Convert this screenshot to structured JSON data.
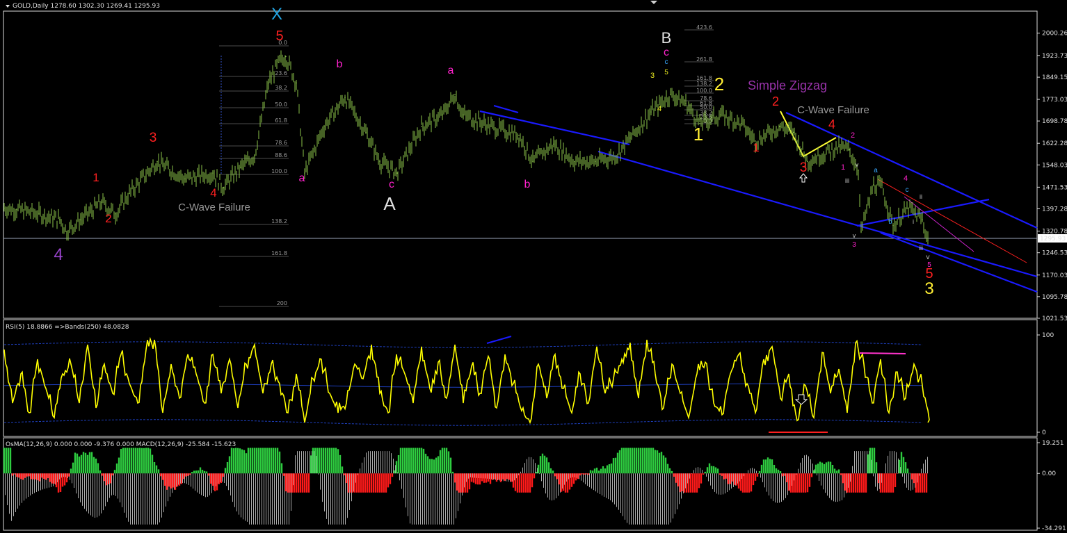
{
  "header": {
    "main": "GOLD,Daily  1278.60 1302.30 1269.41 1295.93",
    "rsi": "RSI(5) 18.8866  =>Bands(250) 48.0828",
    "osma": "OsMA(12,26,9) 0.000 0.000 -9.376 0.000  MACD(12,26,9) -25.584 -15.623"
  },
  "colors": {
    "background": "#000000",
    "candle": "#8bc34a",
    "trendline": "#1a1aff",
    "rsi": "#ffff00",
    "band": "#1e3fbf",
    "macd_pos": "#2ecc40",
    "macd_neg": "#ff1a1a",
    "signal": "#d8d8d8",
    "grid": "#ffffff"
  },
  "chart_data": [
    {
      "type": "line",
      "name": "GOLD,Daily",
      "ylim": [
        1021.53,
        2076.0
      ],
      "y_ticks": [
        "2000.26",
        "1923.73",
        "1849.15",
        "1773.03",
        "1698.78",
        "1622.28",
        "1548.03",
        "1471.53",
        "1397.28",
        "1320.78",
        "1295.93",
        "1246.53",
        "1170.03",
        "1095.78",
        "1021.53"
      ],
      "last_price": "1295.93",
      "series": [
        {
          "x": [
            0,
            18,
            50,
            80,
            90,
            110,
            140,
            160,
            180,
            220,
            260,
            300,
            315,
            340,
            360,
            380,
            395,
            405,
            420,
            432,
            460,
            490,
            520,
            540,
            565,
            600,
            630,
            648,
            660,
            700,
            740,
            760,
            790,
            820,
            850,
            880,
            900,
            930,
            958,
            980,
            1000,
            1030,
            1060,
            1080,
            1115,
            1135,
            1155,
            1200,
            1215,
            1228,
            1232,
            1250,
            1262,
            1278,
            1300,
            1310,
            1320,
            1328
          ],
          "y": [
            1400,
            1395,
            1380,
            1360,
            1320,
            1360,
            1420,
            1380,
            1450,
            1560,
            1500,
            1520,
            1470,
            1540,
            1580,
            1830,
            1900,
            1920,
            1830,
            1520,
            1680,
            1780,
            1660,
            1560,
            1520,
            1680,
            1720,
            1790,
            1720,
            1680,
            1650,
            1560,
            1620,
            1560,
            1560,
            1580,
            1640,
            1730,
            1790,
            1760,
            1690,
            1720,
            1690,
            1630,
            1680,
            1660,
            1560,
            1610,
            1600,
            1530,
            1320,
            1480,
            1470,
            1340,
            1400,
            1380,
            1360,
            1290
          ]
        }
      ],
      "fib_levels": [
        "423.6",
        "261.8",
        "161.8",
        "138.2",
        "100.0",
        "78.6",
        "61.8",
        "50.0",
        "38.2",
        "23.6",
        "0.0",
        "88.6",
        "200"
      ],
      "annotations": [
        {
          "text": "X",
          "color": "#22a8e8"
        },
        {
          "text": "5",
          "color": "#ff2020"
        },
        {
          "text": "B",
          "color": "#e0e0e0"
        },
        {
          "text": "c",
          "color": "#ff22cc"
        },
        {
          "text": "c",
          "color": "#38a8ff"
        },
        {
          "text": "5",
          "color": "#e8e820"
        },
        {
          "text": "b",
          "color": "#ff22cc"
        },
        {
          "text": "a",
          "color": "#ff22cc"
        },
        {
          "text": "3",
          "color": "#ff2020"
        },
        {
          "text": "1",
          "color": "#ff2020"
        },
        {
          "text": "2",
          "color": "#ff2020"
        },
        {
          "text": "4",
          "color": "#ff2020"
        },
        {
          "text": "4",
          "color": "#9944cc"
        },
        {
          "text": "C-Wave Failure",
          "color": "#9a9a9a"
        },
        {
          "text": "a",
          "color": "#ff22cc"
        },
        {
          "text": "c",
          "color": "#ff22cc"
        },
        {
          "text": "A",
          "color": "#e0e0e0"
        },
        {
          "text": "b",
          "color": "#ff22cc"
        },
        {
          "text": "2",
          "color": "#ffee33"
        },
        {
          "text": "1",
          "color": "#ffee33"
        },
        {
          "text": "Simple Zigzag",
          "color": "#9933aa"
        },
        {
          "text": "C-Wave Failure",
          "color": "#9a9a9a"
        },
        {
          "text": "2",
          "color": "#ff2020"
        },
        {
          "text": "4",
          "color": "#ff2020"
        },
        {
          "text": "1",
          "color": "#ff2020"
        },
        {
          "text": "3",
          "color": "#ff2020"
        },
        {
          "text": "2",
          "color": "#ff22cc"
        },
        {
          "text": "1",
          "color": "#ff22cc"
        },
        {
          "text": "v",
          "color": "#c8c8c8"
        },
        {
          "text": "iii",
          "color": "#c8c8c8"
        },
        {
          "text": "a",
          "color": "#38a8ff"
        },
        {
          "text": "4",
          "color": "#ff22cc"
        },
        {
          "text": "c",
          "color": "#38a8ff"
        },
        {
          "text": "ii",
          "color": "#c8c8c8"
        },
        {
          "text": "i",
          "color": "#c8c8c8"
        },
        {
          "text": "b",
          "color": "#38a8ff"
        },
        {
          "text": "v",
          "color": "#c8c8c8"
        },
        {
          "text": "3",
          "color": "#ff22cc"
        },
        {
          "text": "iii",
          "color": "#c8c8c8"
        },
        {
          "text": "v",
          "color": "#c8c8c8"
        },
        {
          "text": "5",
          "color": "#ff22cc"
        },
        {
          "text": "5",
          "color": "#ff2020"
        },
        {
          "text": "3",
          "color": "#ffee33"
        },
        {
          "text": "3",
          "color": "#e8e820"
        },
        {
          "text": "4",
          "color": "#e8e820"
        }
      ]
    },
    {
      "type": "line",
      "name": "RSI(5)",
      "ylim": [
        0,
        100
      ],
      "y_ticks": [
        "100",
        "0"
      ],
      "series": [
        {
          "x": [
            0,
            12,
            24,
            36,
            48,
            60,
            72,
            84,
            96,
            108,
            120,
            132,
            144,
            156,
            168,
            180,
            192,
            204,
            216,
            228,
            240,
            252,
            264,
            276,
            288,
            300,
            312,
            324,
            336,
            348,
            360,
            372,
            384,
            396,
            408,
            420,
            432,
            444,
            456,
            468,
            480,
            492,
            504,
            516,
            528,
            540,
            552,
            564,
            576,
            588,
            600,
            612,
            624,
            636,
            648,
            660,
            672,
            684,
            696,
            708,
            720,
            732,
            744,
            756,
            768,
            780,
            792,
            804,
            816,
            828,
            840,
            852,
            864,
            876,
            888,
            900,
            912,
            924,
            936,
            948,
            960,
            972,
            984,
            996,
            1008,
            1020,
            1032,
            1044,
            1056,
            1068,
            1080,
            1092,
            1104,
            1116,
            1128,
            1140,
            1152,
            1164,
            1176,
            1188,
            1200,
            1212,
            1224,
            1236,
            1248,
            1260,
            1272,
            1284,
            1296,
            1308,
            1320,
            1328
          ],
          "y": [
            85,
            30,
            60,
            20,
            75,
            45,
            15,
            60,
            70,
            30,
            90,
            25,
            70,
            40,
            80,
            50,
            30,
            85,
            95,
            20,
            70,
            35,
            80,
            60,
            30,
            80,
            40,
            75,
            25,
            70,
            90,
            40,
            70,
            50,
            20,
            60,
            10,
            55,
            75,
            40,
            20,
            30,
            70,
            55,
            90,
            40,
            20,
            80,
            60,
            30,
            88,
            45,
            72,
            35,
            90,
            30,
            68,
            40,
            78,
            25,
            80,
            50,
            22,
            10,
            70,
            35,
            80,
            45,
            20,
            60,
            30,
            88,
            40,
            55,
            75,
            92,
            35,
            95,
            60,
            25,
            70,
            40,
            15,
            60,
            72,
            30,
            18,
            60,
            80,
            50,
            20,
            75,
            88,
            35,
            60,
            12,
            48,
            15,
            82,
            40,
            65,
            20,
            92,
            70,
            30,
            75,
            20,
            62,
            35,
            70,
            48,
            10
          ]
        }
      ],
      "bands": {
        "upper": 90,
        "middle": 48,
        "lower": 10
      }
    },
    {
      "type": "bar",
      "name": "OsMA(12,26,9)",
      "ylim": [
        -34.291,
        19.251
      ],
      "y_ticks": [
        "19.251",
        "0.00",
        "-34.291"
      ]
    }
  ]
}
